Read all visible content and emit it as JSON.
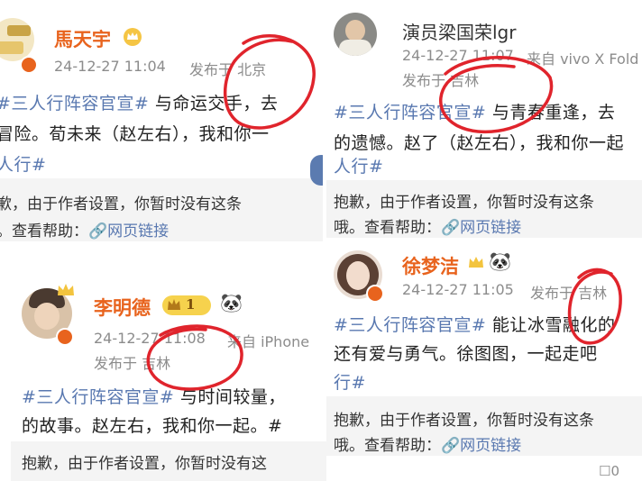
{
  "posts": [
    {
      "name": "馬天宇",
      "timestamp": "24-12-27 11:04",
      "location": "发布于 北京",
      "lines": [
        {
          "tag": "#三人行阵容官宣#",
          "text": " 与命运交手，去"
        },
        {
          "tag": "",
          "text": "冒险。荀未来（赵左右），我和你一"
        },
        {
          "tag": "人行#",
          "text": ""
        }
      ],
      "notice": "歉，由于作者设置，你暂时没有这条",
      "help_label": "。查看帮助：",
      "link": "网页链接"
    },
    {
      "name": "演员梁国荣lgr",
      "timestamp": "24-12-27 11:07",
      "device": "来自 vivo X Fold",
      "location": "发布于 吉林",
      "lines": [
        {
          "tag": "#三人行阵容官宣#",
          "text": " 与青春重逢，去"
        },
        {
          "tag": "",
          "text": "的遗憾。赵了（赵左右），我和你一起"
        },
        {
          "tag": "人行#",
          "text": ""
        }
      ],
      "notice": "抱歉，由于作者设置，你暂时没有这条",
      "help_label": "哦。查看帮助：",
      "link": "网页链接"
    },
    {
      "name": "李明德",
      "level": "1",
      "timestamp": "24-12-27 11:08",
      "device": "来自 iPhone",
      "location": "发布于 吉林",
      "lines": [
        {
          "tag": "#三人行阵容官宣#",
          "text": " 与时间较量，"
        },
        {
          "tag": "",
          "text": "的故事。赵左右，我和你一起。#"
        }
      ],
      "notice": "抱歉，由于作者设置，你暂时没有这"
    },
    {
      "name": "徐梦洁",
      "timestamp": "24-12-27 11:05",
      "location": "发布于 吉林",
      "lines": [
        {
          "tag": "#三人行阵容官宣#",
          "text": " 能让冰雪融化的"
        },
        {
          "tag": "",
          "text": "还有爱与勇气。徐图图，一起走吧"
        },
        {
          "tag": "行#",
          "text": ""
        }
      ],
      "notice": "抱歉，由于作者设置，你暂时没有这条",
      "help_label": "哦。查看帮助：",
      "link": "网页链接",
      "comment_count": "0"
    }
  ],
  "colors": {
    "accent_name": "#e8631d",
    "link": "#5978b0",
    "circle": "#e0242c"
  },
  "icons": {
    "link": "link-chain-icon",
    "vip": "crown-badge-icon",
    "panda": "panda-emoji-icon",
    "comment": "comment-icon"
  }
}
